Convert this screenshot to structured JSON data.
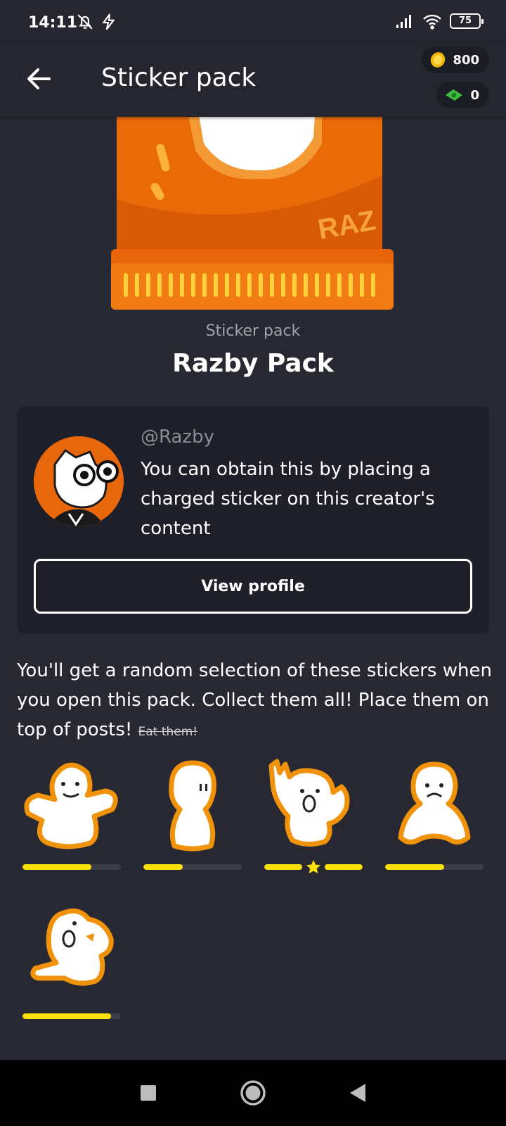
{
  "status_bar": {
    "time": "14:11",
    "battery": "75",
    "icons": [
      "bell-off-icon",
      "bolt-icon",
      "signal-icon",
      "wifi-icon",
      "battery-icon"
    ]
  },
  "app_bar": {
    "title": "Sticker pack",
    "coins": "800",
    "cash": "0"
  },
  "pack": {
    "subtitle": "Sticker pack",
    "title": "Razby Pack",
    "art_signature": "RAZ"
  },
  "creator": {
    "handle": "@Razby",
    "description": "You can obtain this by placing a charged sticker on this creator's content",
    "button_label": "View profile"
  },
  "description": {
    "main": "You'll get a random selection of these stickers when you open this pack. Collect them all! Place them on top of posts!",
    "strikethrough": "Eat them!"
  },
  "stickers": [
    {
      "name": "sticker-sitting",
      "progress": 0.7,
      "completed": false
    },
    {
      "name": "sticker-standing",
      "progress": 0.4,
      "completed": false
    },
    {
      "name": "sticker-rock-on",
      "progress": 1.0,
      "completed": true
    },
    {
      "name": "sticker-sad",
      "progress": 0.6,
      "completed": false
    },
    {
      "name": "sticker-pointing",
      "progress": 0.9,
      "completed": false
    }
  ],
  "colors": {
    "background": "#282833",
    "card": "#1f1f29",
    "accent_orange": "#e8670b",
    "progress_yellow": "#fce00a"
  },
  "nav": [
    "recents-button",
    "home-button",
    "back-button"
  ]
}
